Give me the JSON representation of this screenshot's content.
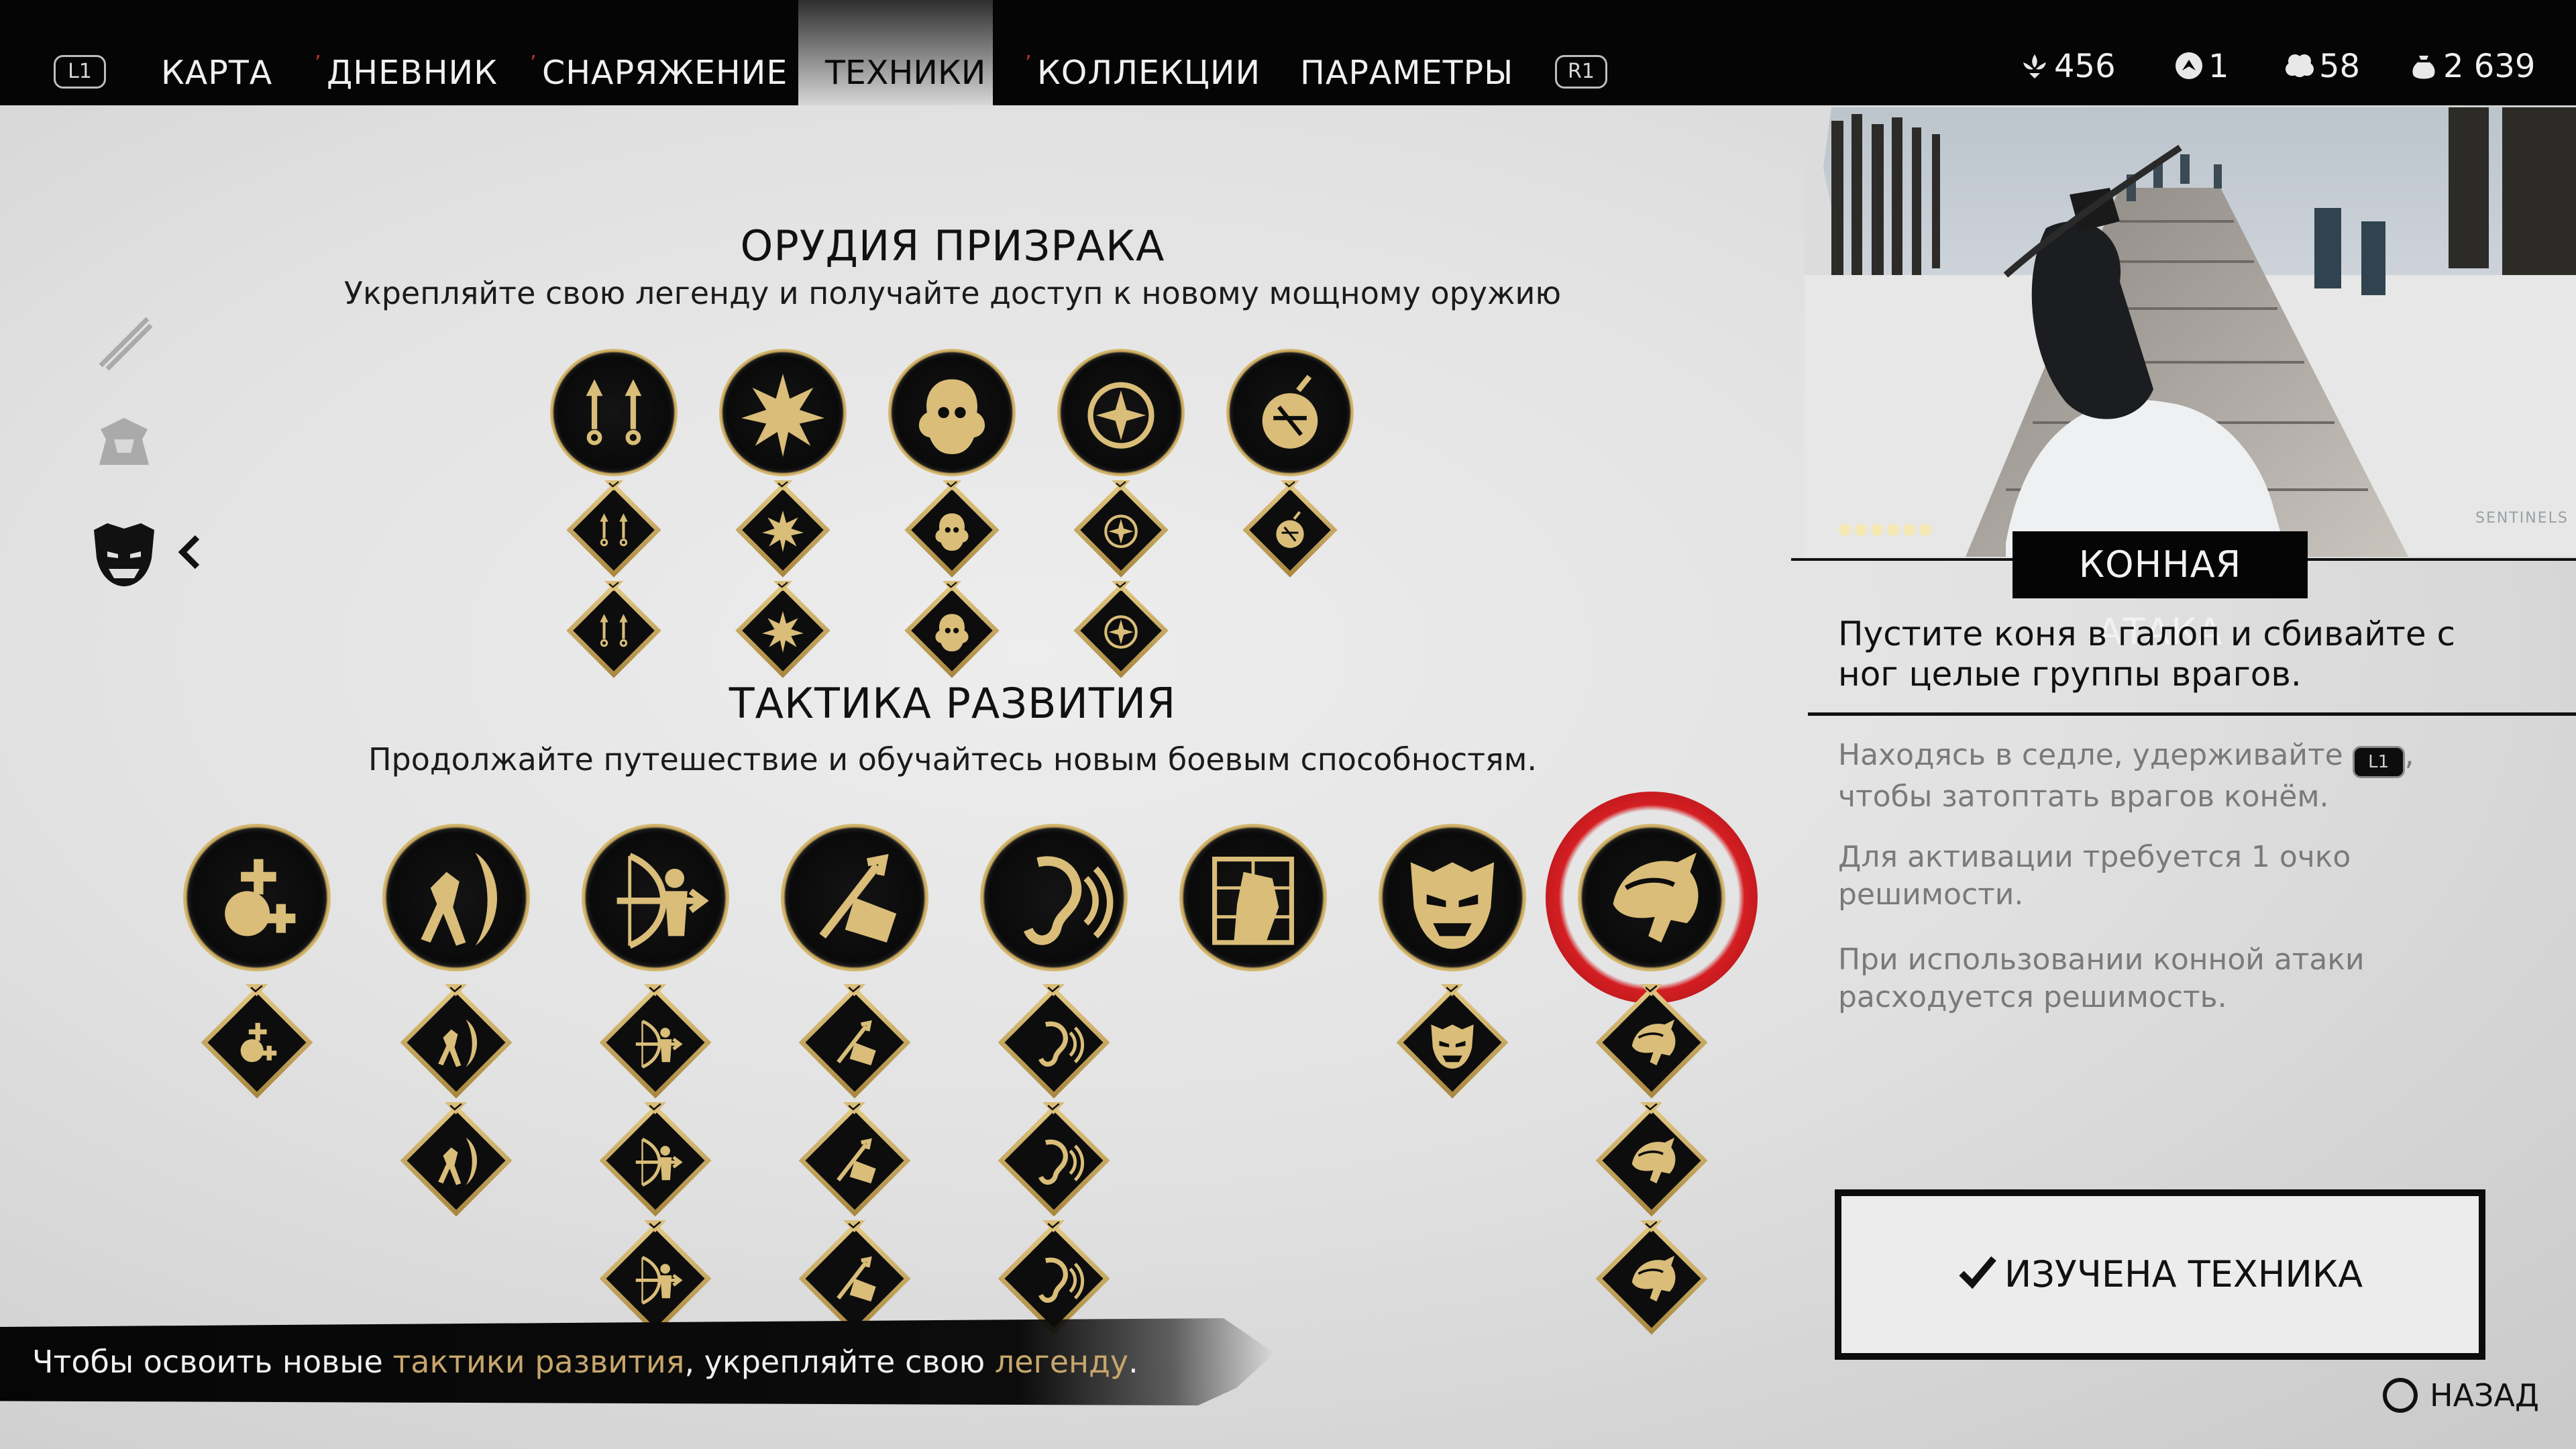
{
  "nav": {
    "left_shoulder": "L1",
    "right_shoulder": "R1",
    "tabs": [
      {
        "label": "КАРТА",
        "mark": ""
      },
      {
        "label": "ДНЕВНИК",
        "mark": "ʼ"
      },
      {
        "label": "СНАРЯЖЕНИЕ",
        "mark": "ʼ"
      },
      {
        "label": "ТЕХНИКИ",
        "mark": ""
      },
      {
        "label": "КОЛЛЕКЦИИ",
        "mark": "ʼ"
      },
      {
        "label": "ПАРАМЕТРЫ",
        "mark": ""
      }
    ],
    "active_tab": "ТЕХНИКИ"
  },
  "resources": [
    {
      "icon": "flower-icon",
      "value": "456"
    },
    {
      "icon": "technique-point-icon",
      "value": "1"
    },
    {
      "icon": "bush-icon",
      "value": "58"
    },
    {
      "icon": "supplies-pouch-icon",
      "value": "2 639"
    }
  ],
  "sections": {
    "ghost": {
      "title": "ОРУДИЯ ПРИЗРАКА",
      "subtitle": "Укрепляйте свою легенду и получайте доступ к новому мощному оружию",
      "columns": [
        {
          "icon": "kunai-icon",
          "upgrades": 2
        },
        {
          "icon": "sticky-bomb-icon",
          "upgrades": 2
        },
        {
          "icon": "wind-chime-icon",
          "upgrades": 2
        },
        {
          "icon": "smoke-bomb-icon",
          "upgrades": 2
        },
        {
          "icon": "black-powder-bomb-icon",
          "upgrades": 1
        }
      ]
    },
    "tactics": {
      "title": "ТАКТИКА РАЗВИТИЯ",
      "subtitle": "Продолжайте путешествие и обучайтесь новым боевым способностям.",
      "columns": [
        {
          "icon": "heal-icon",
          "upgrades": 1
        },
        {
          "icon": "crescent-slash-icon",
          "upgrades": 2
        },
        {
          "icon": "archer-icon",
          "upgrades": 3
        },
        {
          "icon": "arrow-strike-icon",
          "upgrades": 3
        },
        {
          "icon": "focused-hearing-icon",
          "upgrades": 3
        },
        {
          "icon": "assassin-icon",
          "upgrades": 0
        },
        {
          "icon": "oni-mask-icon",
          "upgrades": 1
        },
        {
          "icon": "horse-charge-icon",
          "upgrades": 3,
          "selected": true
        }
      ]
    }
  },
  "detail": {
    "title": "КОННАЯ АТАКА",
    "description": "Пустите коня в галоп и сбивайте с ног целые группы врагов.",
    "note1_before": "Находясь в седле, удерживайте",
    "note1_key": "L1",
    "note1_after": ", чтобы затоптать врагов конём.",
    "note2": "Для активации требуется 1 очко решимости.",
    "note3": "При использовании конной атаки расходуется решимость.",
    "video_watermark": "SENTINELS",
    "learned_button": "ИЗУЧЕНА ТЕХНИКА"
  },
  "back_label": "НАЗАД",
  "hint": {
    "part1": "Чтобы освоить новые ",
    "highlight1": "тактики развития",
    "part2": ", укрепляйте свою ",
    "highlight2": "легенду",
    "part3": "."
  },
  "colors": {
    "gold": "#d9bd78",
    "accent_red": "#d41e22",
    "hint_highlight": "#c7a66c",
    "bar": "#050505"
  }
}
